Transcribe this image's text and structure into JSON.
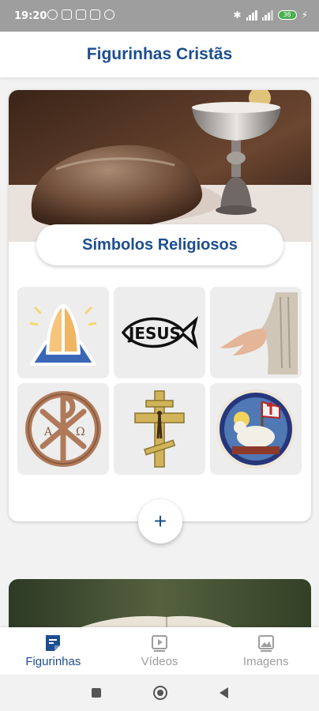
{
  "status_bar": {
    "time": "19:20",
    "battery": "36"
  },
  "app_bar": {
    "title": "Figurinhas Cristãs"
  },
  "category": {
    "title": "Símbolos Religiosos"
  },
  "stickers": [
    {
      "name": "praying-hands"
    },
    {
      "name": "jesus-fish",
      "text": "JESUS"
    },
    {
      "name": "hand-of-jesus"
    },
    {
      "name": "chi-rho",
      "letters": [
        "A",
        "Ω"
      ]
    },
    {
      "name": "orthodox-cross"
    },
    {
      "name": "lamb-of-god"
    }
  ],
  "add_button": {
    "label": "+"
  },
  "bottom_nav": [
    {
      "label": "Figurinhas",
      "icon": "sticker-icon",
      "active": true
    },
    {
      "label": "Vídeos",
      "icon": "video-icon",
      "active": false
    },
    {
      "label": "Imagens",
      "icon": "image-icon",
      "active": false
    }
  ],
  "colors": {
    "primary": "#1d4e8f",
    "inactive": "#9e9e9e",
    "background": "#f2f2f2"
  }
}
